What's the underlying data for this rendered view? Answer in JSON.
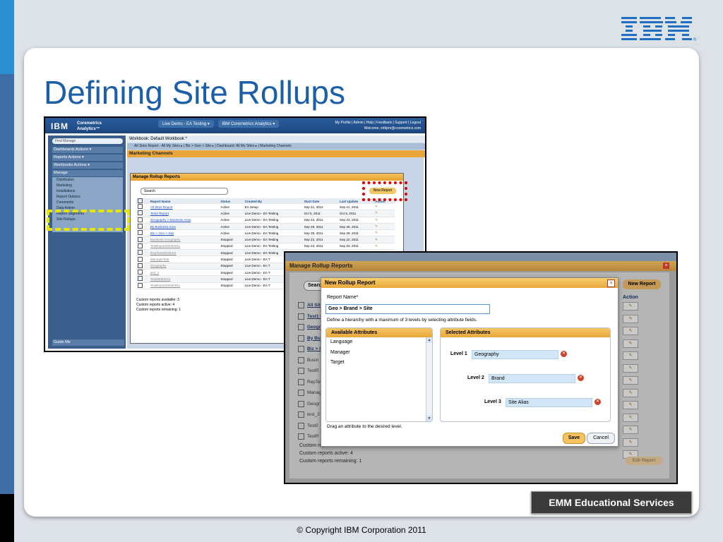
{
  "slide": {
    "logo": "IBM",
    "title": "Defining Site Rollups",
    "footer_badge": "EMM Educational Services",
    "copyright": "© Copyright IBM Corporation 2011",
    "colors": {
      "title": "#1c5fa8",
      "sidebar_blue": "#3f6ea6",
      "accent_orange": "#e9a73b"
    }
  },
  "shot1": {
    "logo": "IBM",
    "brand_line1": "Coremetrics",
    "brand_line2": "Analytics™",
    "top_tabs": [
      "Live Demo - EA Testing ▾",
      "IBM Coremetrics Analytics ▾"
    ],
    "user_links": "My Profile | Admin | Help | Feedback | Support | Logout",
    "welcome": "Welcome, infdpm@coremetrics.com",
    "find_manage": "Find Manage",
    "nav": [
      "Dashboards   Actions ▾",
      "Reports   Actions ▾",
      "Workbooks   Actions ▾",
      "Manage"
    ],
    "manage_items": [
      "Distribution",
      "Marketing",
      "Installations",
      "Report Options",
      "Comments",
      "Data Admin",
      "Report Segments",
      "Site Rollups"
    ],
    "guide": "Guide Me",
    "workbook": "Workbook: Default Workbook *",
    "tabbar": "All Sites Report - All My Sites ▸ | Biz > Geo > Site ▸ | Dashboard: All My Sites ▸ | Marketing Channels",
    "section": "Marketing Channels",
    "dialog_title": "Manage Rollup Reports",
    "search": "Search",
    "new_report": "New Report",
    "columns": [
      "Report Name",
      "Status",
      "Created By",
      "Start Date",
      "Last Update",
      "Action"
    ],
    "rows": [
      [
        "All Sites Report",
        "Active",
        "EA Setup",
        "Sep 21, 2011",
        "Sep 21, 2011"
      ],
      [
        "Test1 Report",
        "Active",
        "Live Demo - EA Testing",
        "Oct 5, 2011",
        "Oct 5, 2011"
      ],
      [
        "Geography > Business Area",
        "Active",
        "Live Demo - EA Testing",
        "Sep 23, 2011",
        "Sep 23, 2011"
      ],
      [
        "By Business Area",
        "Active",
        "Live Demo - EA Testing",
        "Sep 29, 2011",
        "Sep 29, 2011"
      ],
      [
        "Biz > Geo > Site",
        "Active",
        "Live Demo - EA Testing",
        "Sep 29, 2011",
        "Sep 29, 2011"
      ],
      [
        "Business Geography",
        "Stopped",
        "Live Demo - EA Testing",
        "Sep 22, 2011",
        "Sep 22, 2011"
      ],
      [
        "TestReport20092011",
        "Stopped",
        "Live Demo - EA Testing",
        "Sep 23, 2011",
        "Sep 23, 2011"
      ],
      [
        "RepTest09222011",
        "Stopped",
        "Live Demo - EA Testing",
        "Sep 22, 2011",
        "Sep 22, 2011"
      ],
      [
        "ManagerTest",
        "Stopped",
        "Live Demo - EA T",
        "",
        ""
      ],
      [
        "Geography",
        "Stopped",
        "Live Demo - EA T",
        "",
        ""
      ],
      [
        "test_2",
        "Stopped",
        "Live Demo - EA T",
        "",
        ""
      ],
      [
        "Test09082011",
        "Stopped",
        "Live Demo - EA T",
        "",
        ""
      ],
      [
        "TestReport20082011",
        "Stopped",
        "Live Demo - EA T",
        "",
        ""
      ]
    ],
    "footer": [
      "Custom reports available: 3",
      "Custom reports active: 4",
      "Custom reports remaining: 1"
    ]
  },
  "shot2": {
    "manage_title": "Manage Rollup Reports",
    "search": "Search",
    "new_report": "New Report",
    "action_header": "Action",
    "row_stubs": [
      "All Site",
      "Test1 R",
      "Geogr",
      "By Bus",
      "Biz > G",
      "Busin",
      "TestR",
      "RepTe",
      "Manag",
      "Geogr",
      "test_2",
      "Test0",
      "TestR"
    ],
    "footer": [
      "Custom reports available: 3",
      "Custom reports active: 4",
      "Custom reports remaining: 1"
    ],
    "edit_report": "Edit Report"
  },
  "new_rollup": {
    "title": "New Rollup Report",
    "report_name_label": "Report Name*",
    "report_name_value": "Geo > Brand > Site",
    "description": "Define a hierarchy with a maximum of 3 levels by selecting attribute fields.",
    "available_header": "Available Attributes",
    "available": [
      "Language",
      "Manager",
      "Target"
    ],
    "selected_header": "Selected Attributes",
    "levels": [
      {
        "label": "Level 1",
        "value": "Geography"
      },
      {
        "label": "Level 2",
        "value": "Brand"
      },
      {
        "label": "Level 3",
        "value": "Site Alias"
      }
    ],
    "drag_hint": "Drag an attribute to the desired level.",
    "save": "Save",
    "cancel": "Cancel"
  }
}
